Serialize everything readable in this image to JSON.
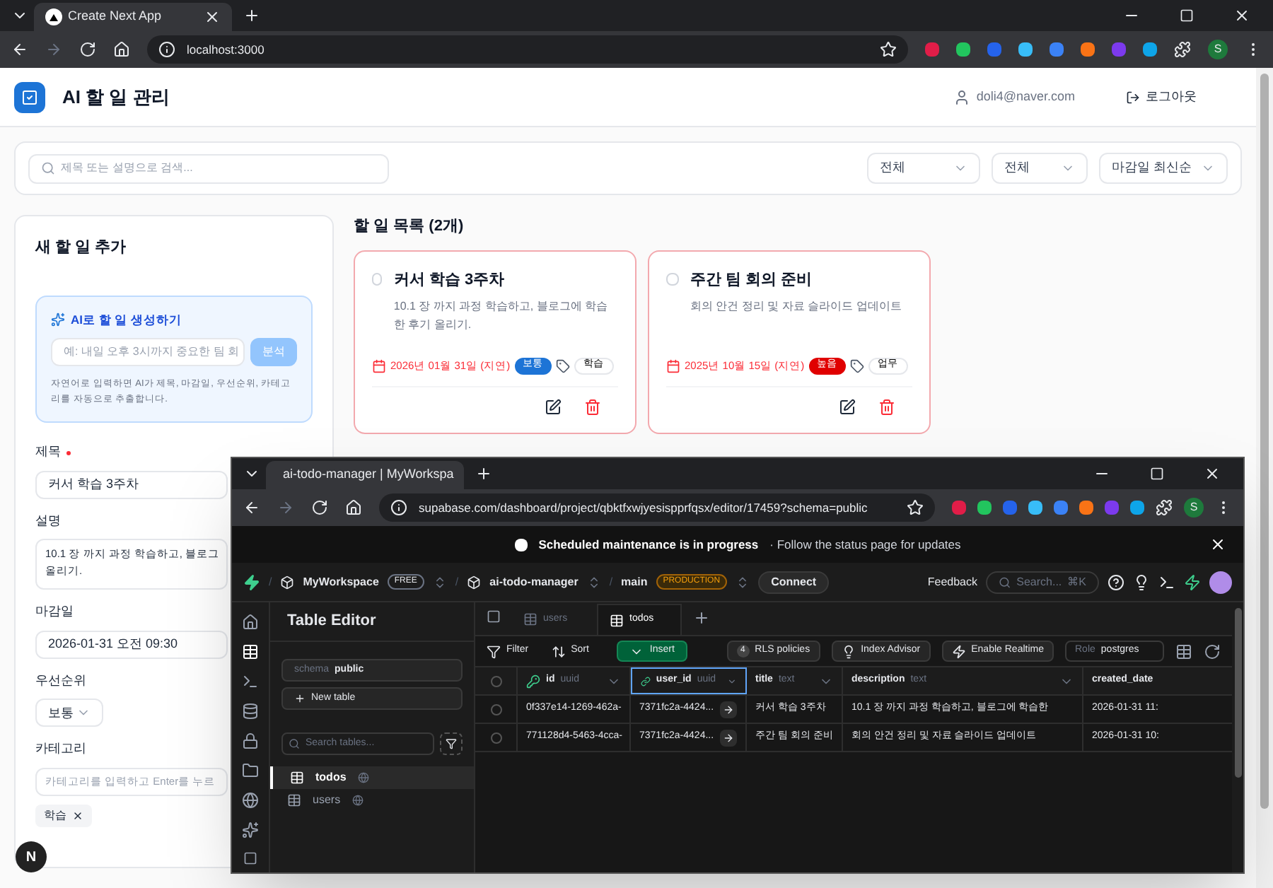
{
  "browser": {
    "tab_title": "Create Next App",
    "url": "localhost:3000",
    "profile_initial": "S"
  },
  "app": {
    "title": "AI 할 일 관리",
    "user_email": "doli4@naver.com",
    "logout": "로그아웃"
  },
  "filters": {
    "search_placeholder": "제목 또는 설명으로 검색...",
    "selects": [
      "전체",
      "전체",
      "마감일 최신순"
    ]
  },
  "new_todo": {
    "heading": "새 할 일 추가",
    "ai": {
      "title": "AI로 할 일 생성하기",
      "placeholder": "예: 내일 오후 3시까지 중요한 팀 회",
      "button": "분석",
      "disabled": true,
      "help": "자연어로 입력하면 AI가 제목, 마감일, 우선순위, 카테고리를 자동으로 추출합니다."
    },
    "fields": [
      {
        "kind": "text",
        "label": "제목",
        "required": true,
        "value": "커서 학습 3주차"
      },
      {
        "kind": "textarea",
        "label": "설명",
        "required": false,
        "value_lines": [
          "10.1 장 까지 과정 학습하고, 블로그",
          "올리기."
        ]
      },
      {
        "kind": "text",
        "label": "마감일",
        "required": false,
        "value": "2026-01-31 오전 09:30"
      },
      {
        "kind": "select",
        "label": "우선순위",
        "required": false,
        "value": "보통"
      },
      {
        "kind": "tags",
        "label": "카테고리",
        "required": false,
        "placeholder": "카테고리를 입력하고 Enter를 누르",
        "tags": [
          "학습"
        ]
      }
    ]
  },
  "todo_list": {
    "heading": "할 일 목록 (2개)",
    "todos": [
      {
        "title": "커서 학습 3주차",
        "description": "10.1 장 까지 과정 학습하고, 블로그에 학습한 후기 올리기.",
        "checked": false,
        "due": "2026년 01월 31일 (지연)",
        "overdue": true,
        "priority": "보통",
        "color": "#1d74d6",
        "category": "학습"
      },
      {
        "title": "주간 팀 회의 준비",
        "description": "회의 안건 정리 및 자료 슬라이드 업데이트",
        "checked": false,
        "due": "2025년 10월 15일 (지연)",
        "overdue": true,
        "priority": "높음",
        "color": "#e00000",
        "category": "업무"
      }
    ]
  },
  "dev_badge": "N",
  "supabase_window": {
    "tab_title": "ai-todo-manager | MyWorkspa",
    "url": "supabase.com/dashboard/project/qbktfxwjyesispprfqsx/editor/17459?schema=public",
    "profile_initial": "S",
    "banner": {
      "title": "Scheduled maintenance is in progress",
      "text": "· Follow the status page for updates"
    },
    "header": {
      "separator": "/",
      "org": "MyWorkspace",
      "org_badge": "FREE",
      "project": "ai-todo-manager",
      "branch": "main",
      "branch_badge": "PRODUCTION",
      "connect": "Connect",
      "feedback": "Feedback",
      "search_placeholder": "Search...",
      "search_shortcut": "⌘K"
    },
    "sidebar": {
      "title": "Table Editor",
      "schema_label": "schema",
      "schema": "public",
      "new_table": "New table",
      "search_placeholder": "Search tables...",
      "tables": [
        {
          "name": "todos",
          "selected": true
        },
        {
          "name": "users",
          "selected": false
        }
      ]
    },
    "tabs": [
      {
        "label": "users",
        "selected": false
      },
      {
        "label": "todos",
        "selected": true
      }
    ],
    "toolbar": {
      "filter": "Filter",
      "sort": "Sort",
      "insert": "Insert",
      "rls_count": "4",
      "rls": "RLS policies",
      "index_advisor": "Index Advisor",
      "realtime": "Enable Realtime",
      "role_label": "Role",
      "role": "postgres"
    },
    "select_all_checked": false,
    "columns": [
      {
        "name": "id",
        "type": "uuid",
        "kind": "key",
        "selected": false
      },
      {
        "name": "user_id",
        "type": "uuid",
        "kind": "link",
        "selected": true
      },
      {
        "name": "title",
        "type": "text",
        "kind": "plain",
        "selected": false
      },
      {
        "name": "description",
        "type": "text",
        "kind": "plain",
        "selected": false
      },
      {
        "name": "created_date",
        "kind": "plain",
        "selected": false
      }
    ],
    "rows": [
      {
        "checked": false,
        "cells": [
          "0f337e14-1269-462a-",
          "7371fc2a-4424...",
          "커서 학습 3주차",
          "10.1 장 까지 과정 학습하고, 블로그에 학습한",
          "2026-01-31 11:"
        ]
      },
      {
        "checked": false,
        "cells": [
          "771128d4-5463-4cca-",
          "7371fc2a-4424...",
          "주간 팀 회의 준비",
          "회의 안건 정리 및 자료 슬라이드 업데이트",
          "2026-01-31 10:"
        ]
      }
    ]
  }
}
